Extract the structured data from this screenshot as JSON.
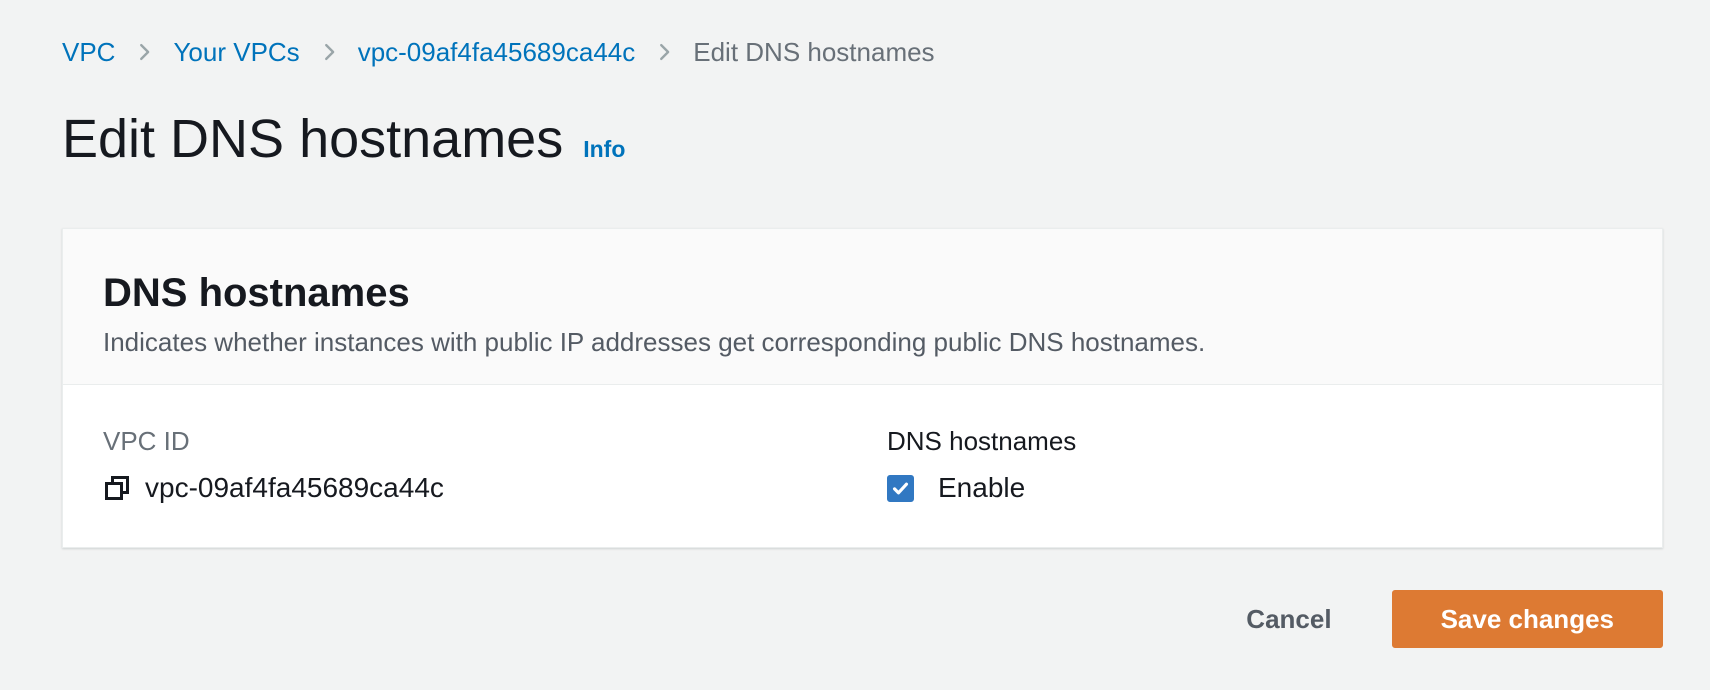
{
  "breadcrumb": {
    "items": [
      {
        "label": "VPC"
      },
      {
        "label": "Your VPCs"
      },
      {
        "label": "vpc-09af4fa45689ca44c"
      },
      {
        "label": "Edit DNS hostnames"
      }
    ]
  },
  "header": {
    "title": "Edit DNS hostnames",
    "info_label": "Info"
  },
  "card": {
    "title": "DNS hostnames",
    "description": "Indicates whether instances with public IP addresses get corresponding public DNS hostnames.",
    "fields": {
      "vpc_id": {
        "label": "VPC ID",
        "value": "vpc-09af4fa45689ca44c"
      },
      "dns_hostnames": {
        "label": "DNS hostnames",
        "checkbox_label": "Enable",
        "checked": true
      }
    }
  },
  "footer": {
    "cancel_label": "Cancel",
    "save_label": "Save changes"
  },
  "icons": {
    "breadcrumb_separator": "chevron-right-icon",
    "vpc_id_copy": "copy-icon",
    "checkbox_mark": "check-icon"
  },
  "colors": {
    "page_bg": "#f2f3f3",
    "link_blue": "#0073bb",
    "checkbox_blue": "#3178c2",
    "primary_button_orange": "#dd7a33",
    "muted_text": "#687078",
    "card_header_bg": "#fafafa"
  }
}
